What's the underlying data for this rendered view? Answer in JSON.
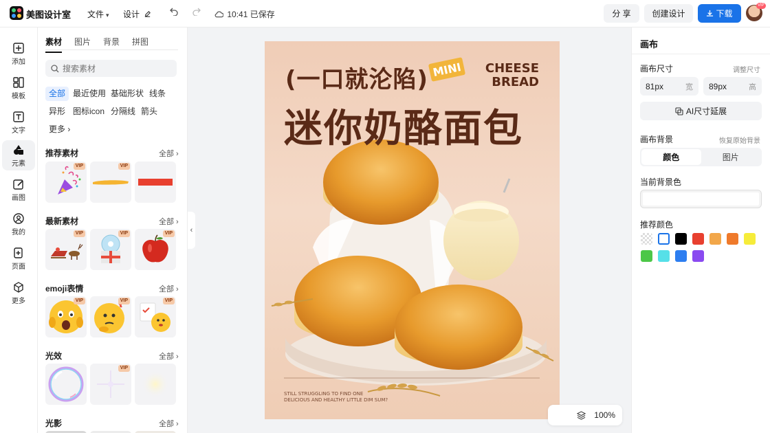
{
  "topbar": {
    "brand": "美图设计室",
    "file_menu": "文件",
    "design_menu": "设计",
    "saved_status": "10:41 已保存",
    "share_label": "分 享",
    "create_label": "创建设计",
    "download_label": "下载",
    "vip_badge": "VIP"
  },
  "rail": {
    "items": [
      {
        "label": "添加",
        "icon": "plus-square-icon"
      },
      {
        "label": "模板",
        "icon": "template-icon"
      },
      {
        "label": "文字",
        "icon": "text-icon"
      },
      {
        "label": "元素",
        "icon": "shapes-icon"
      },
      {
        "label": "画图",
        "icon": "pencil-icon"
      },
      {
        "label": "我的",
        "icon": "user-icon"
      },
      {
        "label": "页面",
        "icon": "page-add-icon"
      },
      {
        "label": "更多",
        "icon": "cube-icon"
      }
    ]
  },
  "panel": {
    "tabs": [
      "素材",
      "图片",
      "背景",
      "拼图"
    ],
    "search_placeholder": "搜索素材",
    "chips": [
      "全部",
      "最近使用",
      "基础形状",
      "线条",
      "异形",
      "图标icon",
      "分隔线",
      "箭头",
      "更多"
    ],
    "sections": [
      {
        "title": "推荐素材",
        "all": "全部"
      },
      {
        "title": "最新素材",
        "all": "全部"
      },
      {
        "title": "emoji表情",
        "all": "全部"
      },
      {
        "title": "光效",
        "all": "全部"
      },
      {
        "title": "光影",
        "all": "全部"
      }
    ],
    "vip": "VIP"
  },
  "poster": {
    "hook": "(一口就沦陷)",
    "mini": "MINI",
    "cheese_line1": "CHEESE",
    "cheese_line2": "BREAD",
    "title": "迷你奶酪面包",
    "small_line1": "STILL STRUGGLING TO FIND ONE",
    "small_line2": "DELICIOUS AND HEALTHY LITTLE DIM SUM?"
  },
  "canvas": {
    "zoom": "100%"
  },
  "right": {
    "title": "画布",
    "size_label": "画布尺寸",
    "adjust_size": "调整尺寸",
    "width_value": "81px",
    "width_unit": "宽",
    "height_value": "89px",
    "height_unit": "高",
    "ai_extend": "AI尺寸延展",
    "bg_label": "画布背景",
    "restore_bg": "恢复原始背景",
    "seg_color": "颜色",
    "seg_image": "图片",
    "current_bg": "当前背景色",
    "recommended": "推荐颜色",
    "swatches": [
      "transparent",
      "#ffffff",
      "#000000",
      "#e8402f",
      "#f2a74a",
      "#ef7a2b",
      "#f6ec3a",
      "#4cc748",
      "#56e0e8",
      "#2d7ef0",
      "#8a4af0"
    ]
  }
}
